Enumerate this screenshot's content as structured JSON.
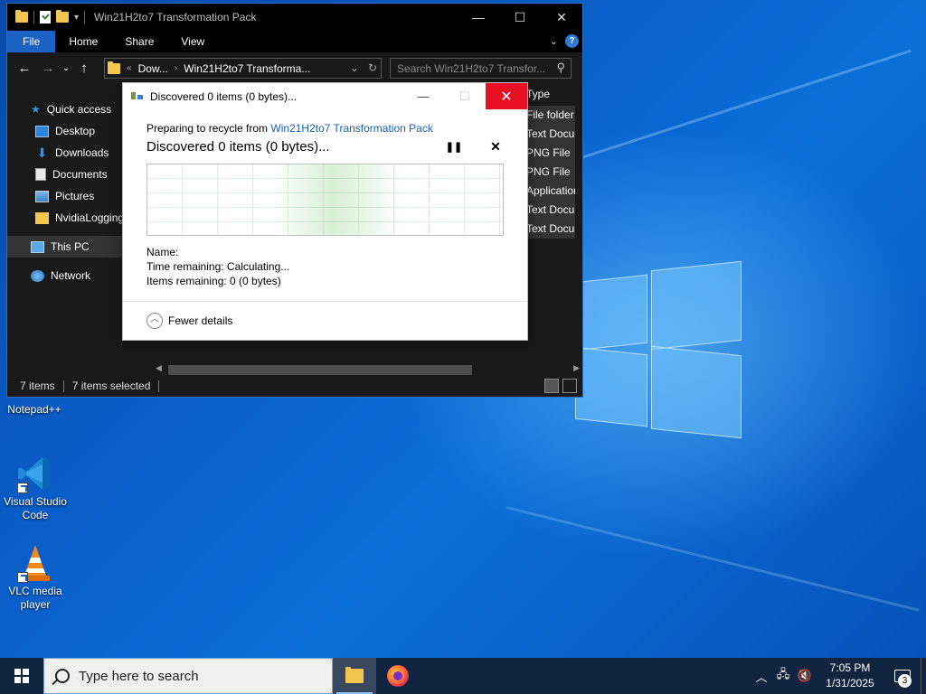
{
  "explorer": {
    "title": "Win21H2to7 Transformation Pack",
    "ribbon_tabs": [
      "File",
      "Home",
      "Share",
      "View"
    ],
    "address_segments": [
      "Dow...",
      "Win21H2to7 Transforma..."
    ],
    "search_placeholder": "Search Win21H2to7 Transfor...",
    "nav_items": [
      {
        "label": "Quick access",
        "icon": "star-icon"
      },
      {
        "label": "Desktop",
        "icon": "desktop-icon"
      },
      {
        "label": "Downloads",
        "icon": "download-icon"
      },
      {
        "label": "Documents",
        "icon": "documents-icon"
      },
      {
        "label": "Pictures",
        "icon": "pictures-icon"
      },
      {
        "label": "NvidiaLogging",
        "icon": "folder-icon"
      },
      {
        "label": "This PC",
        "icon": "computer-icon"
      },
      {
        "label": "Network",
        "icon": "network-icon"
      }
    ],
    "type_column": {
      "header": "Type",
      "rows": [
        "File folder",
        "Text Docum",
        "PNG File",
        "PNG File",
        "Application",
        "Text Docum",
        "Text Docum"
      ]
    },
    "status": {
      "items": "7 items",
      "selected": "7 items selected"
    }
  },
  "dialog": {
    "title": "Discovered 0 items (0 bytes)...",
    "preparing_prefix": "Preparing to recycle from",
    "preparing_link": "Win21H2to7 Transformation Pack",
    "discovered": "Discovered 0 items (0 bytes)...",
    "name_label": "Name:",
    "time_remaining": "Time remaining:  Calculating...",
    "items_remaining": "Items remaining:  0 (0 bytes)",
    "fewer_details": "Fewer details"
  },
  "desktop_icons": [
    {
      "label": "Notepad++",
      "icon": "notepadpp-icon"
    },
    {
      "label": "Visual Studio Code",
      "icon": "vscode-icon"
    },
    {
      "label": "VLC media player",
      "icon": "vlc-icon"
    }
  ],
  "taskbar": {
    "search_placeholder": "Type here to search",
    "time": "7:05 PM",
    "date": "1/31/2025",
    "notification_count": "3"
  },
  "colors": {
    "accent": "#1a63c4",
    "close_red": "#e81123",
    "link": "#1a5fb4"
  }
}
